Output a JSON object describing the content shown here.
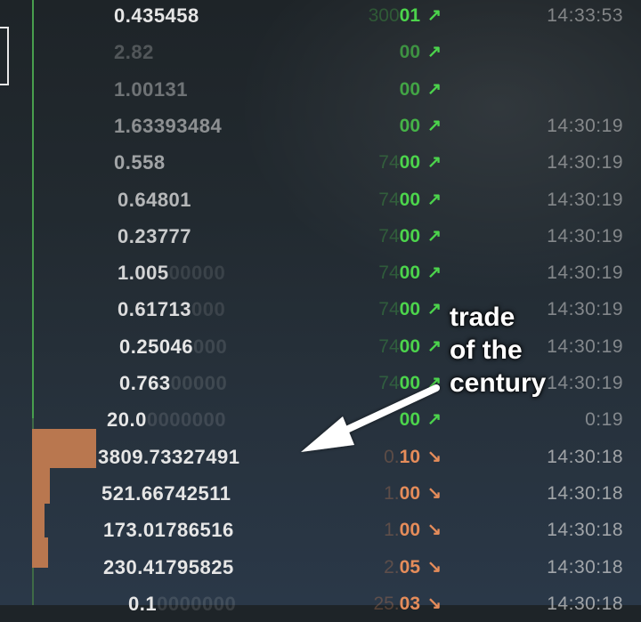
{
  "theme": {
    "buy_color": "#4cd44c",
    "sell_color": "#e58c5a",
    "amount_color": "#e6e6e6",
    "time_color": "#cfcfcf",
    "depth_bar_color": "#b9774f"
  },
  "trades": [
    {
      "side": "buy",
      "amount_main": "0.435458",
      "amount_faded": "",
      "qty_prefix": "300",
      "qty_main": "01",
      "arrow": "↗",
      "time": "14:33:53",
      "amount_opacity": 1.0
    },
    {
      "side": "buy",
      "amount_main": "2.82",
      "amount_faded": "",
      "qty_prefix": "",
      "qty_main": "00",
      "arrow": "↗",
      "time": "",
      "amount_opacity": 0.25
    },
    {
      "side": "buy",
      "amount_main": "1.00131",
      "amount_faded": "",
      "qty_prefix": "",
      "qty_main": "00",
      "arrow": "↗",
      "time": "",
      "amount_opacity": 0.4
    },
    {
      "side": "buy",
      "amount_main": "1.63393484",
      "amount_faded": "",
      "qty_prefix": "",
      "qty_main": "00",
      "arrow": "↗",
      "time": "14:30:19",
      "amount_opacity": 0.55
    },
    {
      "side": "buy",
      "amount_main": "0.558",
      "amount_faded": "",
      "qty_prefix": "74",
      "qty_main": "00",
      "arrow": "↗",
      "time": "14:30:19",
      "amount_opacity": 0.65
    },
    {
      "side": "buy",
      "amount_main": "0.64801",
      "amount_faded": "",
      "qty_prefix": "74",
      "qty_main": "00",
      "arrow": "↗",
      "time": "14:30:19",
      "amount_opacity": 0.75
    },
    {
      "side": "buy",
      "amount_main": "0.23777",
      "amount_faded": "",
      "qty_prefix": "74",
      "qty_main": "00",
      "arrow": "↗",
      "time": "14:30:19",
      "amount_opacity": 0.85
    },
    {
      "side": "buy",
      "amount_main": "1.005",
      "amount_faded": "00000",
      "qty_prefix": "74",
      "qty_main": "00",
      "arrow": "↗",
      "time": "14:30:19",
      "amount_opacity": 0.9
    },
    {
      "side": "buy",
      "amount_main": "0.61713",
      "amount_faded": "000",
      "qty_prefix": "74",
      "qty_main": "00",
      "arrow": "↗",
      "time": "14:30:19",
      "amount_opacity": 0.95
    },
    {
      "side": "buy",
      "amount_main": "0.25046",
      "amount_faded": "000",
      "qty_prefix": "74",
      "qty_main": "00",
      "arrow": "↗",
      "time": "14:30:19",
      "amount_opacity": 1.0
    },
    {
      "side": "buy",
      "amount_main": "0.763",
      "amount_faded": "00000",
      "qty_prefix": "74",
      "qty_main": "00",
      "arrow": "↗",
      "time": "14:30:19",
      "amount_opacity": 1.0
    },
    {
      "side": "buy",
      "amount_main": "20.0",
      "amount_faded": "0000000",
      "qty_prefix": "",
      "qty_main": "00",
      "arrow": "↗",
      "time": "0:19",
      "amount_opacity": 1.0
    },
    {
      "side": "sell",
      "amount_main": "3809.73327491",
      "amount_faded": "",
      "qty_prefix": "0.",
      "qty_main": "10",
      "arrow": "↘",
      "time": "14:30:18",
      "amount_opacity": 1.0
    },
    {
      "side": "sell",
      "amount_main": "521.66742511",
      "amount_faded": "",
      "qty_prefix": "1.",
      "qty_main": "00",
      "arrow": "↘",
      "time": "14:30:18",
      "amount_opacity": 1.0
    },
    {
      "side": "sell",
      "amount_main": "173.01786516",
      "amount_faded": "",
      "qty_prefix": "1.",
      "qty_main": "00",
      "arrow": "↘",
      "time": "14:30:18",
      "amount_opacity": 1.0
    },
    {
      "side": "sell",
      "amount_main": "230.41795825",
      "amount_faded": "",
      "qty_prefix": "2.",
      "qty_main": "05",
      "arrow": "↘",
      "time": "14:30:18",
      "amount_opacity": 1.0
    },
    {
      "side": "sell",
      "amount_main": "0.1",
      "amount_faded": "0000000",
      "qty_prefix": "25.",
      "qty_main": "03",
      "arrow": "↘",
      "time": "14:30:18",
      "amount_opacity": 1.0
    }
  ],
  "annotation": {
    "lines": [
      "trade",
      "of the",
      "century"
    ]
  }
}
